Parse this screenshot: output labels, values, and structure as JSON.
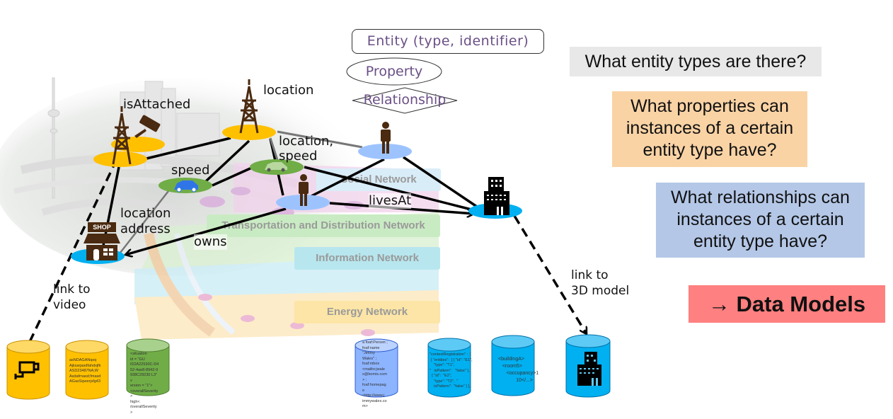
{
  "legend": {
    "entity": "Entity (type, identifier)",
    "property": "Property",
    "relationship": "Relationship"
  },
  "questions": {
    "entity_types": "What entity types are there?",
    "properties": "What properties can instances of a certain entity type have?",
    "relationships": "What relationships can instances of a certain entity type have?",
    "conclusion": "→ Data Models"
  },
  "colors": {
    "entity_type_box": "#e8e8e8",
    "property_box": "#fad3a5",
    "relationship_box": "#b4c7e7",
    "conclusion_box": "#ff8080",
    "legend_text": "#6a4f86",
    "tower_node": "#ffc000",
    "vehicle_node": "#70ad47",
    "person_node": "#9dc3ff",
    "building_node": "#00b0f0",
    "icon_brown": "#4a2a10"
  },
  "graph": {
    "labels": {
      "isAttached": "isAttached",
      "location": "location",
      "location_speed_1": "location,",
      "location_speed_2": "speed",
      "speed": "speed",
      "location_address_1": "location",
      "location_address_2": "address",
      "owns": "owns",
      "livesAt": "livesAt",
      "link_video_1": "link to",
      "link_video_2": "video",
      "link_3d_1": "link to",
      "link_3d_2": "3D model"
    },
    "nodes": [
      {
        "name": "camera-tower",
        "icon": "tower-icon"
      },
      {
        "name": "camera",
        "icon": "camera-icon"
      },
      {
        "name": "tower",
        "icon": "tower-icon"
      },
      {
        "name": "car-1",
        "icon": "car-icon"
      },
      {
        "name": "car-2",
        "icon": "car-icon"
      },
      {
        "name": "person-1",
        "icon": "person-icon"
      },
      {
        "name": "person-2",
        "icon": "person-icon"
      },
      {
        "name": "shop",
        "icon": "shop-icon"
      },
      {
        "name": "building",
        "icon": "building-icon"
      }
    ]
  },
  "background_networks": [
    "Social Network",
    "Transportation and Distribution Network",
    "Information Network",
    "Energy Network"
  ],
  "shop_sign": "SHOP",
  "databases": [
    {
      "name": "video-db",
      "icon": "camera-icon",
      "color": "#ffc000"
    },
    {
      "name": "encoded-db",
      "color": "#ffc000",
      "text": "asNDAGANqsq\nAjksarjasdfahdsjfk\nASD23487NA;W\nAsdafrnasd;fmasd\nAGasSqwerjsfg43"
    },
    {
      "name": "xml-situation-db",
      "color": "#70ad47",
      "text": "<situation\nid = \"GU\nID2A22530C-D4\n52-4ae8-8942-9\n938C29230 L3\"\nv\nersion = \"1\">\n<overallSeverity\n>\nhigh<\n/overallSeverity\n>"
    },
    {
      "name": "rdf-db",
      "color": "#5b9bff",
      "text": "a foaf:Person ;\nfoaf:name\n\"Jimmy\nWales\" ;\nfoaf:mbox\n<mailto:jwale\ns@bomis.com\n> ;\nfoaf:homepag\ne\n<http://www.j\nimmywales.co\nm>"
    },
    {
      "name": "json-ngsi-db",
      "color": "#00b0f0",
      "text": "\"contextRegistration\" :  [\n { \"entities\":  [ { \"id\": \"E1\",\n    \"type\": \"T1\",\n\"   isPattern\":   \"false\" },\n  { \"id\":  \"E2\",\n    \"type\": \"T2\",  \"\n    isPattern\":  \"false\" } ],"
    },
    {
      "name": "xml-building-db",
      "color": "#00b0f0",
      "text": "<buildingA>\n   <room5>\n      <occupancy>1\n             10</...>"
    },
    {
      "name": "3d-model-db",
      "icon": "building-icon",
      "color": "#00b0f0"
    }
  ]
}
